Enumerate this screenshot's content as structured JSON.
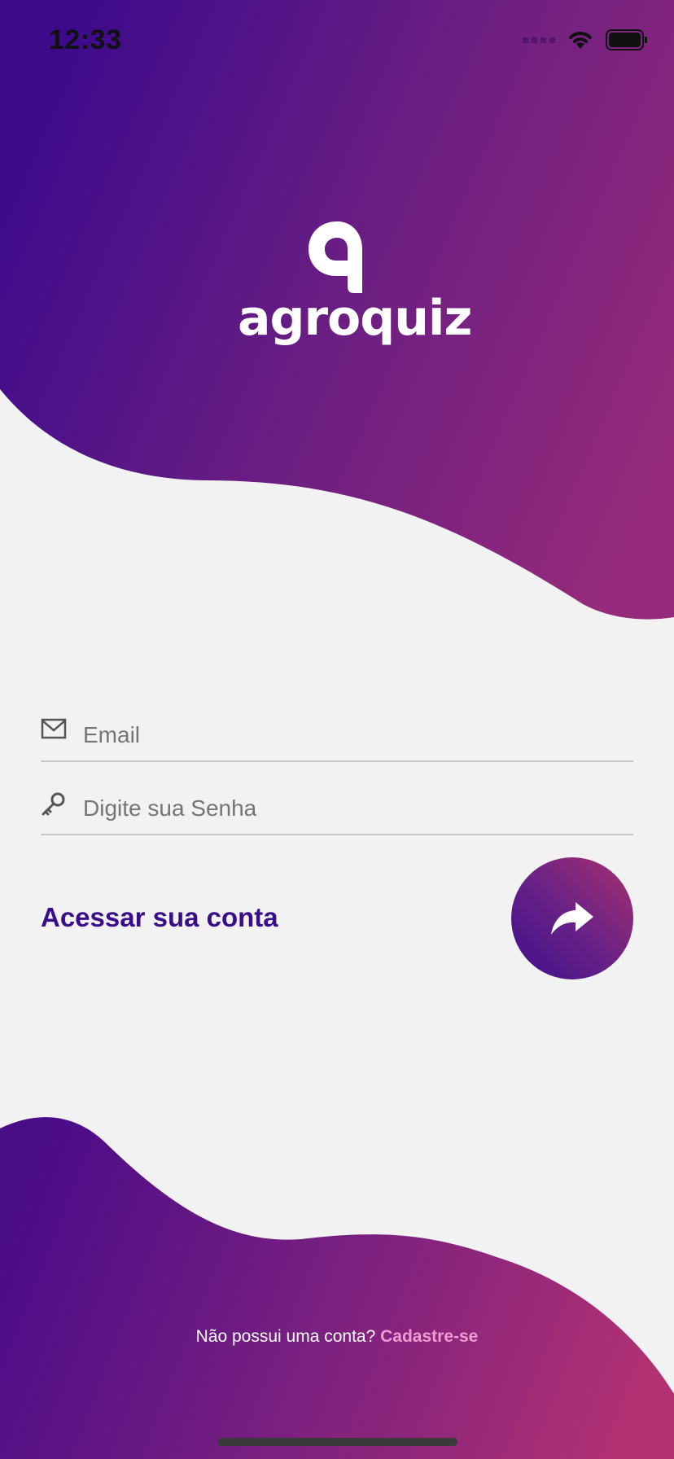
{
  "status_bar": {
    "time": "12:33"
  },
  "brand": {
    "name": "agroquiz"
  },
  "form": {
    "email_placeholder": "Email",
    "password_placeholder": "Digite sua Senha",
    "title": "Acessar sua conta"
  },
  "footer": {
    "prompt": "Não possui uma conta?",
    "signup_link": "Cadastre-se"
  },
  "icons": {
    "email": "envelope-icon",
    "password": "key-icon",
    "submit": "share-arrow-icon",
    "wifi": "wifi-icon",
    "battery": "battery-icon",
    "signal": "cellular-signal-icon"
  },
  "colors": {
    "gradient_start": "#3d0a8c",
    "gradient_mid": "#6a1e82",
    "gradient_end": "#a12e78",
    "background": "#f2f2f2",
    "accent_text": "#3a0d8a",
    "link": "#f29ad4"
  }
}
